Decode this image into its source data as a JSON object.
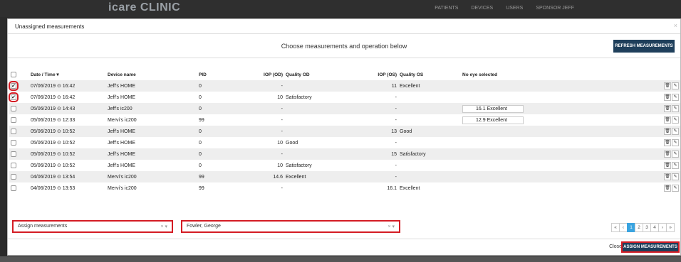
{
  "topbar": {
    "brand": "icare CLINIC",
    "nav": [
      "PATIENTS",
      "DEVICES",
      "USERS"
    ],
    "user": "SPONSOR JEFF"
  },
  "modal": {
    "title": "Unassigned measurements",
    "close": "×",
    "choose_text": "Choose measurements and operation below",
    "refresh_label": "REFRESH MEASUREMENTS",
    "columns": [
      "Date / Time ▾",
      "Device name",
      "PID",
      "IOP (OD)",
      "Quality OD",
      "IOP (OS)",
      "Quality OS",
      "No eye selected"
    ],
    "rows": [
      {
        "checked": true,
        "date": "07/06/2019 ⊙ 16:42",
        "device": "Jeff's HOME",
        "pid": "0",
        "iop_od": "-",
        "q_od": "",
        "iop_os": "11",
        "q_os": "Excellent",
        "no_eye": ""
      },
      {
        "checked": true,
        "date": "07/06/2019 ⊙ 16:42",
        "device": "Jeff's HOME",
        "pid": "0",
        "iop_od": "10",
        "q_od": "Satisfactory",
        "iop_os": "-",
        "q_os": "",
        "no_eye": ""
      },
      {
        "checked": false,
        "date": "05/06/2019 ⊙ 14:43",
        "device": "Jeff's ic200",
        "pid": "0",
        "iop_od": "-",
        "q_od": "",
        "iop_os": "-",
        "q_os": "",
        "no_eye": "16.1   Excellent"
      },
      {
        "checked": false,
        "date": "05/06/2019 ⊙ 12:33",
        "device": "Mervi's ic200",
        "pid": "99",
        "iop_od": "-",
        "q_od": "",
        "iop_os": "-",
        "q_os": "",
        "no_eye": "12.9   Excellent"
      },
      {
        "checked": false,
        "date": "05/06/2019 ⊙ 10:52",
        "device": "Jeff's HOME",
        "pid": "0",
        "iop_od": "-",
        "q_od": "",
        "iop_os": "13",
        "q_os": "Good",
        "no_eye": ""
      },
      {
        "checked": false,
        "date": "05/06/2019 ⊙ 10:52",
        "device": "Jeff's HOME",
        "pid": "0",
        "iop_od": "10",
        "q_od": "Good",
        "iop_os": "-",
        "q_os": "",
        "no_eye": ""
      },
      {
        "checked": false,
        "date": "05/06/2019 ⊙ 10:52",
        "device": "Jeff's HOME",
        "pid": "0",
        "iop_od": "-",
        "q_od": "",
        "iop_os": "15",
        "q_os": "Satisfactory",
        "no_eye": ""
      },
      {
        "checked": false,
        "date": "05/06/2019 ⊙ 10:52",
        "device": "Jeff's HOME",
        "pid": "0",
        "iop_od": "10",
        "q_od": "Satisfactory",
        "iop_os": "-",
        "q_os": "",
        "no_eye": ""
      },
      {
        "checked": false,
        "date": "04/06/2019 ⊙ 13:54",
        "device": "Mervi's ic200",
        "pid": "99",
        "iop_od": "14.6",
        "q_od": "Excellent",
        "iop_os": "-",
        "q_os": "",
        "no_eye": ""
      },
      {
        "checked": false,
        "date": "04/06/2019 ⊙ 13:53",
        "device": "Mervi's ic200",
        "pid": "99",
        "iop_od": "-",
        "q_od": "",
        "iop_os": "16.1",
        "q_os": "Excellent",
        "no_eye": ""
      }
    ],
    "operation_select": "Assign measurements",
    "patient_select": "Fowler, George",
    "select_clear": "× ▾",
    "pagination": [
      "«",
      "‹",
      "1",
      "2",
      "3",
      "4",
      "›",
      "»"
    ],
    "pagination_active": "1",
    "close_label": "Close",
    "assign_label": "ASSIGN MEASUREMENTS",
    "delete_icon_glyph": "🗑",
    "edit_icon_glyph": "✎"
  }
}
